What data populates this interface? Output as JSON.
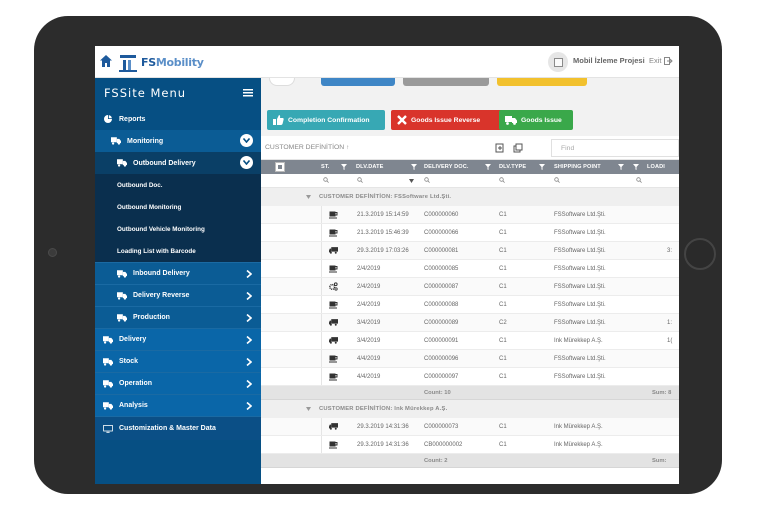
{
  "topbar": {
    "logo_prefix": "FS",
    "logo_suffix": "Mobility",
    "project_name": "Mobil İzleme Projesi",
    "exit_label": "Exit"
  },
  "sidebar": {
    "title": "FSSite Menu",
    "items": [
      {
        "label": "Reports",
        "icon": "pie-chart-icon",
        "level": 0
      },
      {
        "label": "Monitoring",
        "icon": "truck-icon",
        "level": 1,
        "expanded": true
      },
      {
        "label": "Outbound Delivery",
        "icon": "truck-icon",
        "level": 1,
        "expanded": true
      },
      {
        "label": "Outbound Doc.",
        "level": 2
      },
      {
        "label": "Outbound Monitoring",
        "level": 2
      },
      {
        "label": "Outbound Vehicle Monitoring",
        "level": 2
      },
      {
        "label": "Loading List with Barcode",
        "level": 2
      },
      {
        "label": "Inbound Delivery",
        "icon": "truck-icon",
        "level": 1
      },
      {
        "label": "Delivery Reverse",
        "icon": "truck-icon",
        "level": 1
      },
      {
        "label": "Production",
        "icon": "truck-icon",
        "level": 1
      },
      {
        "label": "Delivery",
        "icon": "truck-icon",
        "level": 0
      },
      {
        "label": "Stock",
        "icon": "truck-icon",
        "level": 0
      },
      {
        "label": "Operation",
        "icon": "truck-icon",
        "level": 0
      },
      {
        "label": "Analysis",
        "icon": "truck-icon",
        "level": 0
      },
      {
        "label": "Customization & Master Data",
        "icon": "monitor-icon",
        "level": 0
      }
    ]
  },
  "toolbar": {
    "completion_label": "Completion Confirmation",
    "reverse_label": "Goods Issue Reverse",
    "goods_issue_label": "Goods Issue"
  },
  "grid": {
    "group_label": "CUSTOMER DEFİNİTİON",
    "find_placeholder": "Find",
    "columns": [
      "ST.",
      "DLV.DATE",
      "DELIVERY DOC.",
      "DLV.TYPE",
      "SHIPPING POINT",
      "LOADI"
    ],
    "date_filter_value": "Q",
    "groups": [
      {
        "title": "CUSTOMER DEFİNİTİON: FSSoftware Ltd.Şti.",
        "rows": [
          {
            "status": "coffee-icon",
            "date": "21.3.2019 15:14:59",
            "doc": "C000000060",
            "type": "C1",
            "ship": "FSSoftware Ltd.Şti.",
            "load": ""
          },
          {
            "status": "coffee-icon",
            "date": "21.3.2019 15:46:39",
            "doc": "C000000066",
            "type": "C1",
            "ship": "FSSoftware Ltd.Şti.",
            "load": ""
          },
          {
            "status": "truck-icon",
            "date": "29.3.2019 17:03:26",
            "doc": "C000000081",
            "type": "C1",
            "ship": "FSSoftware Ltd.Şti.",
            "load": "3:"
          },
          {
            "status": "coffee-icon",
            "date": "2/4/2019",
            "doc": "C000000085",
            "type": "C1",
            "ship": "FSSoftware Ltd.Şti.",
            "load": ""
          },
          {
            "status": "gears-icon",
            "date": "2/4/2019",
            "doc": "C000000087",
            "type": "C1",
            "ship": "FSSoftware Ltd.Şti.",
            "load": ""
          },
          {
            "status": "coffee-icon",
            "date": "2/4/2019",
            "doc": "C000000088",
            "type": "C1",
            "ship": "FSSoftware Ltd.Şti.",
            "load": ""
          },
          {
            "status": "truck-icon",
            "date": "3/4/2019",
            "doc": "C000000089",
            "type": "C2",
            "ship": "FSSoftware Ltd.Şti.",
            "load": "1:"
          },
          {
            "status": "truck-icon",
            "date": "3/4/2019",
            "doc": "C000000091",
            "type": "C1",
            "ship": "Ink Mürekkep A.Ş.",
            "load": "1("
          },
          {
            "status": "coffee-icon",
            "date": "4/4/2019",
            "doc": "C000000096",
            "type": "C1",
            "ship": "FSSoftware Ltd.Şti.",
            "load": ""
          },
          {
            "status": "coffee-icon",
            "date": "4/4/2019",
            "doc": "C000000097",
            "type": "C1",
            "ship": "FSSoftware Ltd.Şti.",
            "load": ""
          }
        ],
        "count": "Count: 10",
        "sum": "Sum: 8"
      },
      {
        "title": "CUSTOMER DEFİNİTİON: Ink Mürekkep A.Ş.",
        "rows": [
          {
            "status": "truck-icon",
            "date": "29.3.2019 14:31:36",
            "doc": "C000000073",
            "type": "C1",
            "ship": "Ink Mürekkep A.Ş.",
            "load": ""
          },
          {
            "status": "coffee-icon",
            "date": "29.3.2019 14:31:36",
            "doc": "CB000000002",
            "type": "C1",
            "ship": "Ink Mürekkep A.Ş.",
            "load": ""
          }
        ],
        "count": "Count: 2",
        "sum": "Sum:"
      }
    ]
  }
}
